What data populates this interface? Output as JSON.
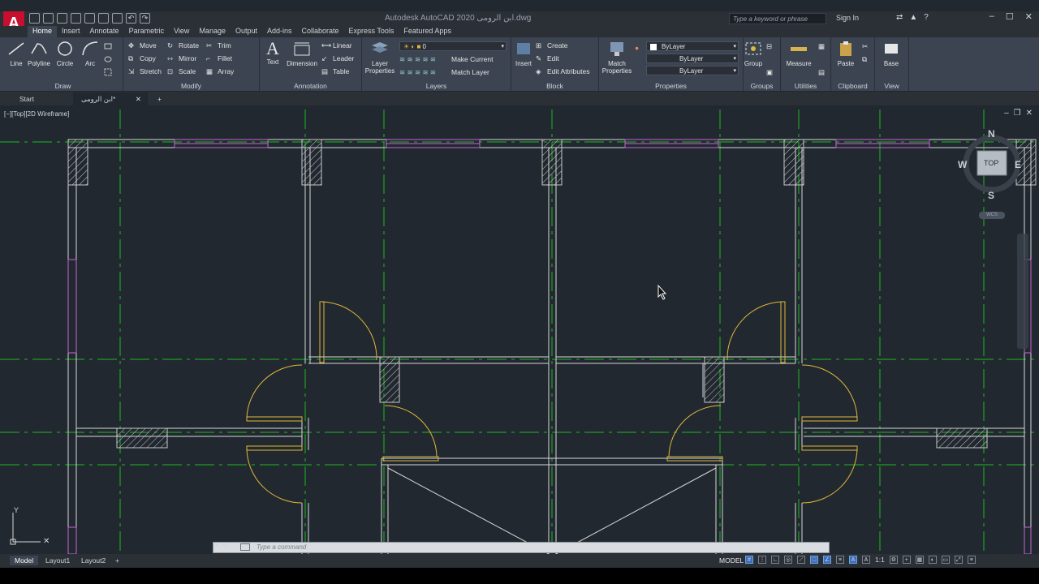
{
  "app": {
    "logo": "A",
    "title": "Autodesk AutoCAD 2020  ابن الرومى.dwg",
    "search_placeholder": "Type a keyword or phrase",
    "signin": "Sign In",
    "accent": "#c8102e"
  },
  "ribbon_tabs": [
    "Home",
    "Insert",
    "Annotate",
    "Parametric",
    "View",
    "Manage",
    "Output",
    "Add-ins",
    "Collaborate",
    "Express Tools",
    "Featured Apps"
  ],
  "ribbon": {
    "draw": {
      "label": "Draw",
      "tools": [
        "Line",
        "Polyline",
        "Circle",
        "Arc"
      ]
    },
    "modify": {
      "label": "Modify",
      "tools": [
        "Move",
        "Rotate",
        "Trim",
        "Copy",
        "Mirror",
        "Fillet",
        "Stretch",
        "Scale",
        "Array"
      ]
    },
    "annotation": {
      "label": "Annotation",
      "text": "Text",
      "dimension": "Dimension",
      "linear": "Linear",
      "leader": "Leader",
      "table": "Table"
    },
    "layers": {
      "label": "Layers",
      "layer_properties": "Layer\nProperties",
      "current_layer": "0",
      "make_current": "Make Current",
      "match_layer": "Match Layer"
    },
    "block": {
      "label": "Block",
      "insert": "Insert",
      "create": "Create",
      "edit": "Edit",
      "edit_attributes": "Edit Attributes"
    },
    "properties": {
      "label": "Properties",
      "match": "Match\nProperties",
      "color": "ByLayer",
      "linetype": "ByLayer",
      "lineweight": "ByLayer"
    },
    "groups": {
      "label": "Groups",
      "group": "Group"
    },
    "utilities": {
      "label": "Utilities",
      "measure": "Measure"
    },
    "clipboard": {
      "label": "Clipboard",
      "paste": "Paste"
    },
    "view": {
      "label": "View",
      "base": "Base"
    }
  },
  "file_tabs": [
    "Start",
    "ابن الرومى*"
  ],
  "viewport": {
    "label": "[−][Top][2D Wireframe]",
    "viewcube": {
      "top": "TOP",
      "n": "N",
      "s": "S",
      "e": "E",
      "w": "W",
      "wcs": "WCS"
    }
  },
  "command": {
    "placeholder": "Type  a  command"
  },
  "layout_tabs": [
    "Model",
    "Layout1",
    "Layout2"
  ],
  "status": {
    "model": "MODEL",
    "scale": "1:1"
  },
  "colors": {
    "axis": "#1fb81f",
    "wall": "#d8d8d8",
    "door": "#e1b93a",
    "window": "#c866d6",
    "hatch": "#c9c9c9"
  }
}
